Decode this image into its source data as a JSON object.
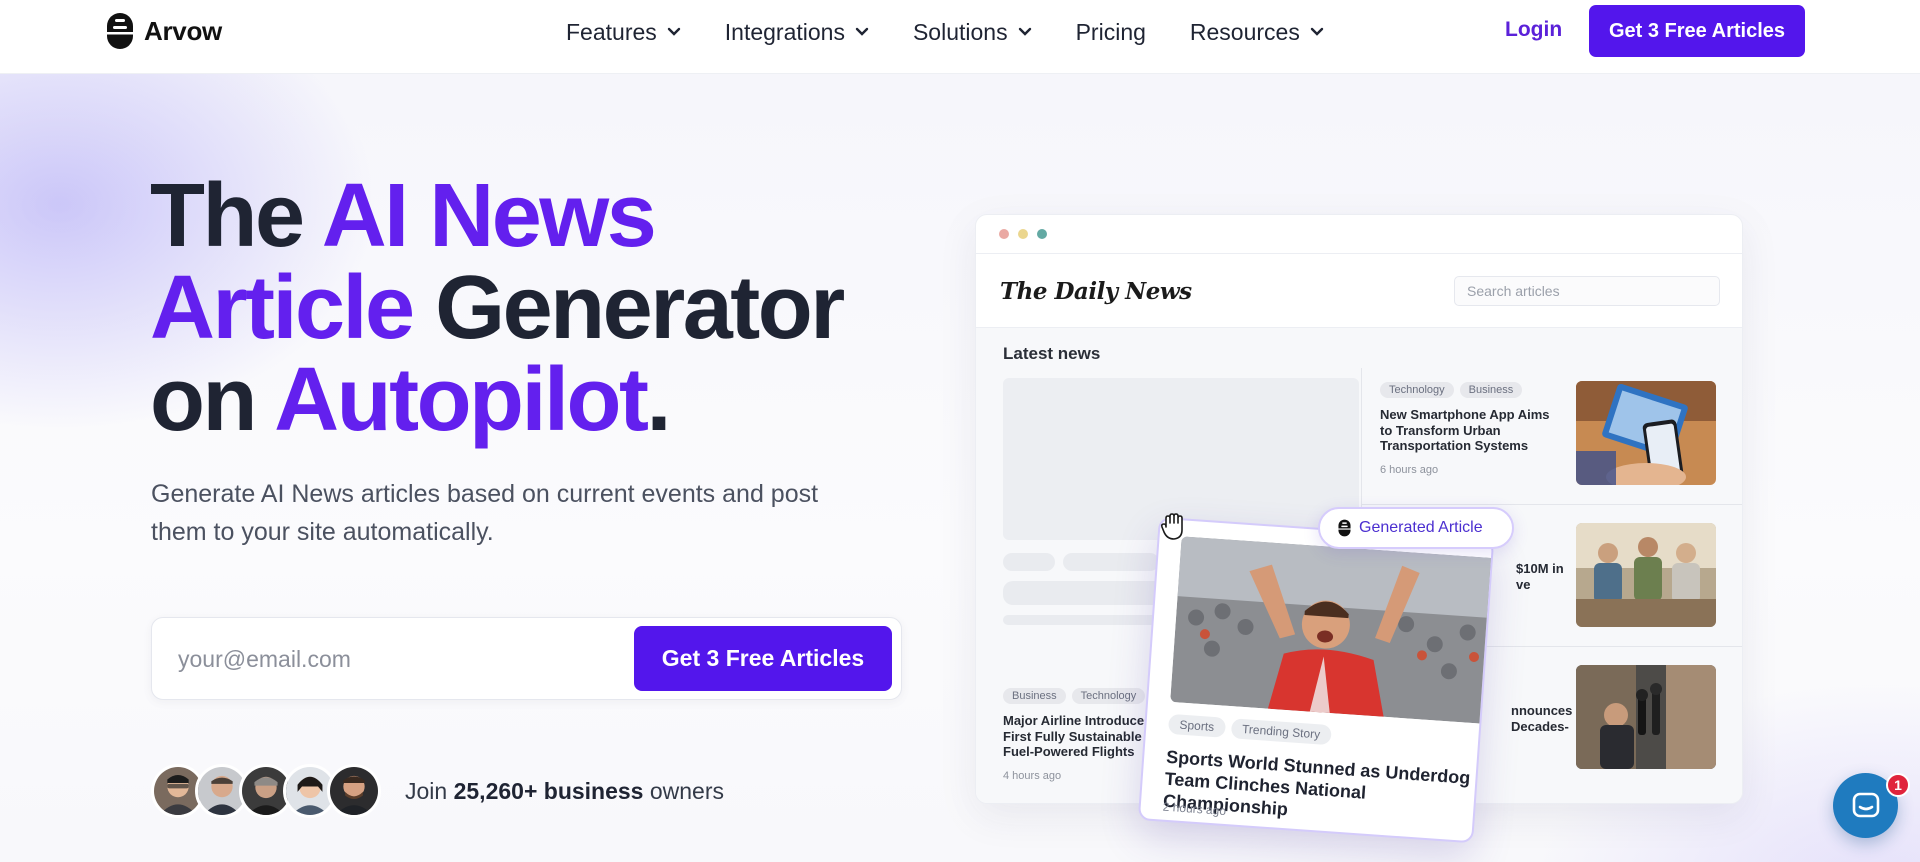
{
  "brand": {
    "name": "Arvow"
  },
  "nav": {
    "items": [
      {
        "label": "Features",
        "has_dropdown": true
      },
      {
        "label": "Integrations",
        "has_dropdown": true
      },
      {
        "label": "Solutions",
        "has_dropdown": true
      },
      {
        "label": "Pricing",
        "has_dropdown": false
      },
      {
        "label": "Resources",
        "has_dropdown": true
      }
    ],
    "login": "Login",
    "cta": "Get 3 Free Articles"
  },
  "hero": {
    "headline": {
      "w1": "The",
      "w2": "AI News",
      "w3": "Article",
      "w4": "Generator",
      "w5": "on",
      "w6": "Autopilot",
      "w7": "."
    },
    "subtext": "Generate AI News articles based on current events and post them to your site automatically.",
    "email_placeholder": "your@email.com",
    "form_cta": "Get 3 Free Articles",
    "social_prefix": "Join",
    "social_count": "25,260+ business",
    "social_suffix": "owners"
  },
  "mockup": {
    "site_logo": "The Daily News",
    "search_placeholder": "Search articles",
    "section_title": "Latest news",
    "articles": [
      {
        "tags": [
          "Technology",
          "Business"
        ],
        "title": "New Smartphone App Aims to Transform Urban Transportation Systems",
        "time": "6 hours ago"
      },
      {
        "title_fragment_1": "$10M in",
        "title_fragment_2": "ve"
      },
      {
        "title_fragment_1": "nnounces",
        "title_fragment_2": "Decades-"
      },
      {
        "tags": [
          "Business",
          "Technology"
        ],
        "title": "Major Airline Introduces First Fully Sustainable Fuel-Powered Flights",
        "time": "4 hours ago"
      }
    ],
    "generated_badge": "Generated Article",
    "generated": {
      "tags": [
        "Sports",
        "Trending Story"
      ],
      "title": "Sports World Stunned as Underdog Team Clinches National Championship",
      "time": "2 hours ago"
    }
  },
  "chat": {
    "unread": "1"
  },
  "colors": {
    "brand": "#5316ec",
    "accent_text": "#6320ee",
    "chat": "#1f7bbf"
  }
}
